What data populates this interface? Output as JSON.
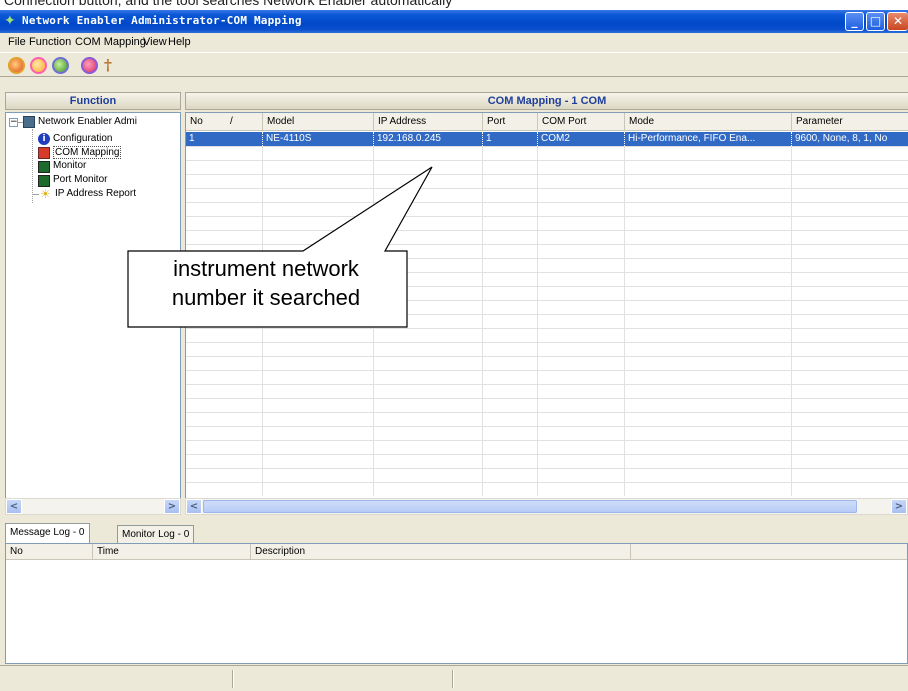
{
  "top_caption": "Connection button, and the tool searches Network Enabler automatically",
  "window": {
    "title": "Network Enabler Administrator-COM Mapping",
    "menu": [
      "File",
      "Function",
      "COM Mapping",
      "View",
      "Help"
    ]
  },
  "toolbar": {
    "icons": [
      "search-icon",
      "refresh-icon",
      "settings-icon",
      "connect-icon",
      "help-icon"
    ]
  },
  "left_panel": {
    "title": "Function",
    "tree": [
      {
        "label": "Network Enabler Admi",
        "icon": "network-icon"
      },
      {
        "label": "Configuration",
        "icon": "info-icon"
      },
      {
        "label": "COM Mapping",
        "icon": "com-mapping-icon"
      },
      {
        "label": "Monitor",
        "icon": "monitor-icon"
      },
      {
        "label": "Port Monitor",
        "icon": "port-monitor-icon"
      },
      {
        "label": "IP Address Report",
        "icon": "bulb-icon"
      }
    ]
  },
  "main_panel": {
    "title": "COM Mapping - 1 COM",
    "columns": [
      "No",
      "/",
      "Model",
      "IP Address",
      "Port",
      "COM Port",
      "Mode",
      "Parameter"
    ],
    "rows": [
      {
        "no": "1",
        "model": "NE-4110S",
        "ip": "192.168.0.245",
        "port": "1",
        "com": "COM2",
        "mode": "Hi-Performance, FIFO Ena...",
        "param": "9600, None, 8, 1, No"
      }
    ]
  },
  "callout": {
    "text_line1": "instrument network",
    "text_line2": "number it searched"
  },
  "bottom": {
    "tabs": [
      "Message Log - 0",
      "Monitor Log - 0"
    ],
    "columns": [
      "No",
      "Time",
      "Description"
    ]
  },
  "colors": {
    "title_bar": "#0a58d6",
    "selection": "#316ac5",
    "header_text": "#1e3e9a"
  }
}
